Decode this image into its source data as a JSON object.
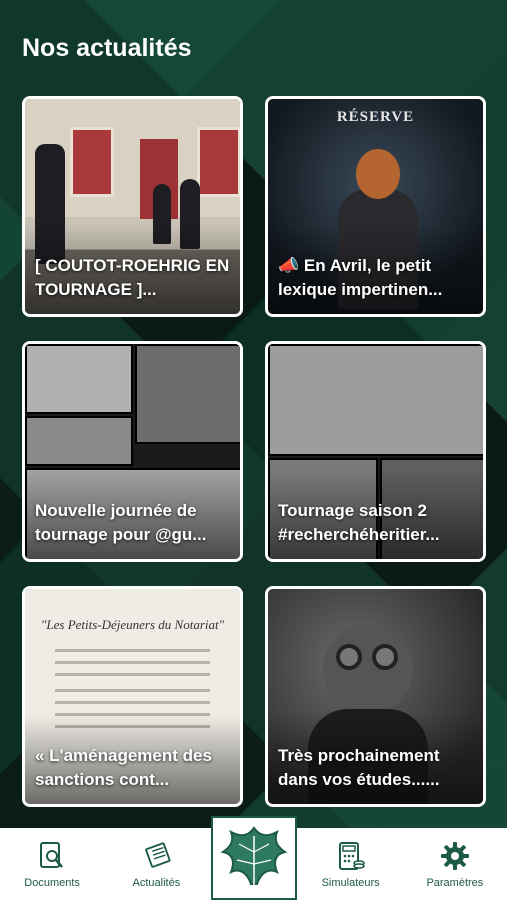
{
  "header": {
    "title": "Nos actualités"
  },
  "cards": [
    {
      "caption": "[ COUTOT-ROEHRIG EN TOURNAGE ]..."
    },
    {
      "caption": "📣 En Avril, le petit lexique impertinen...",
      "image_heading": "RÉSERVE"
    },
    {
      "caption": "Nouvelle journée de tournage pour @gu..."
    },
    {
      "caption": "Tournage saison 2 #recherchéheritier..."
    },
    {
      "caption": "« L'aménagement des sanctions cont...",
      "image_heading": "\"Les Petits-Déjeuners du Notariat\""
    },
    {
      "caption": "Très prochainement dans vos études......"
    }
  ],
  "nav": {
    "documents": "Documents",
    "actualites": "Actualités",
    "simulateurs": "Simulateurs",
    "parametres": "Paramètres"
  },
  "colors": {
    "accent": "#1c5a47",
    "background": "#0d1f1a"
  },
  "icons": {
    "documents": "document-search-icon",
    "actualites": "newspaper-icon",
    "simulateurs": "calculator-icon",
    "parametres": "gear-icon",
    "logo": "leaf-logo"
  }
}
